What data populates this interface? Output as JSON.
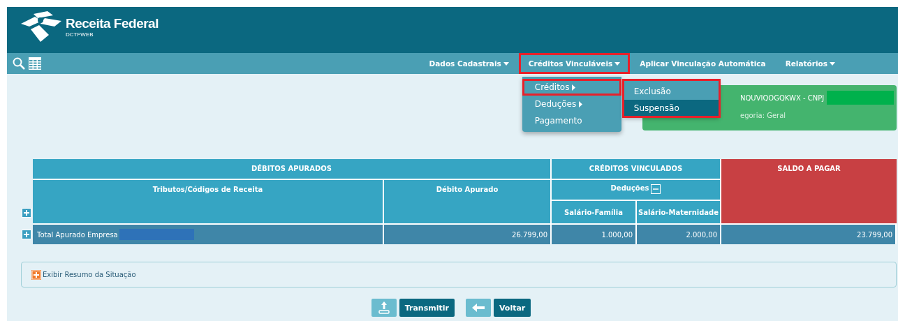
{
  "header": {
    "title": "Receita Federal",
    "subtitle": "DCTFWEB"
  },
  "nav": [
    {
      "label": "Dados Cadastrais",
      "caret": true,
      "highlighted": false
    },
    {
      "label": "Créditos Vinculáveis",
      "caret": true,
      "highlighted": true
    },
    {
      "label": "Aplicar Vinculação Automática",
      "caret": false,
      "highlighted": false
    },
    {
      "label": "Relatórios",
      "caret": true,
      "highlighted": false
    }
  ],
  "dropdown": {
    "items": [
      {
        "label": "Créditos",
        "submenu": true,
        "highlighted": true
      },
      {
        "label": "Deduções",
        "submenu": true,
        "highlighted": false
      },
      {
        "label": "Pagamento",
        "submenu": false,
        "highlighted": false
      }
    ],
    "submenu": {
      "highlighted": true,
      "items": [
        {
          "label": "Exclusão",
          "selected": false
        },
        {
          "label": "Suspensão",
          "selected": true
        }
      ]
    }
  },
  "info_box": {
    "lines": [
      "NQUVIQOGQKWX - CNPJ",
      "egoria: Geral"
    ]
  },
  "table": {
    "groups": [
      "DÉBITOS APURADOS",
      "CRÉDITOS VINCULADOS",
      "SALDO A PAGAR"
    ],
    "columns": [
      "Tributos/Códigos de Receita",
      "Débito Apurado"
    ],
    "subgroup": {
      "label": "Deduções",
      "expanded": true
    },
    "subcolumns": [
      "Salário-Família",
      "Salário-Maternidade"
    ],
    "row": {
      "label": "Total Apurado Empresa",
      "values": [
        "26.799,00",
        "1.000,00",
        "2.000,00",
        "23.799,00"
      ]
    }
  },
  "summary": {
    "label": "Exibir Resumo da Situação",
    "expanded": false
  },
  "buttons": [
    {
      "label": "Transmitir",
      "kind": "upload"
    },
    {
      "label": "Voltar",
      "kind": "back"
    }
  ]
}
